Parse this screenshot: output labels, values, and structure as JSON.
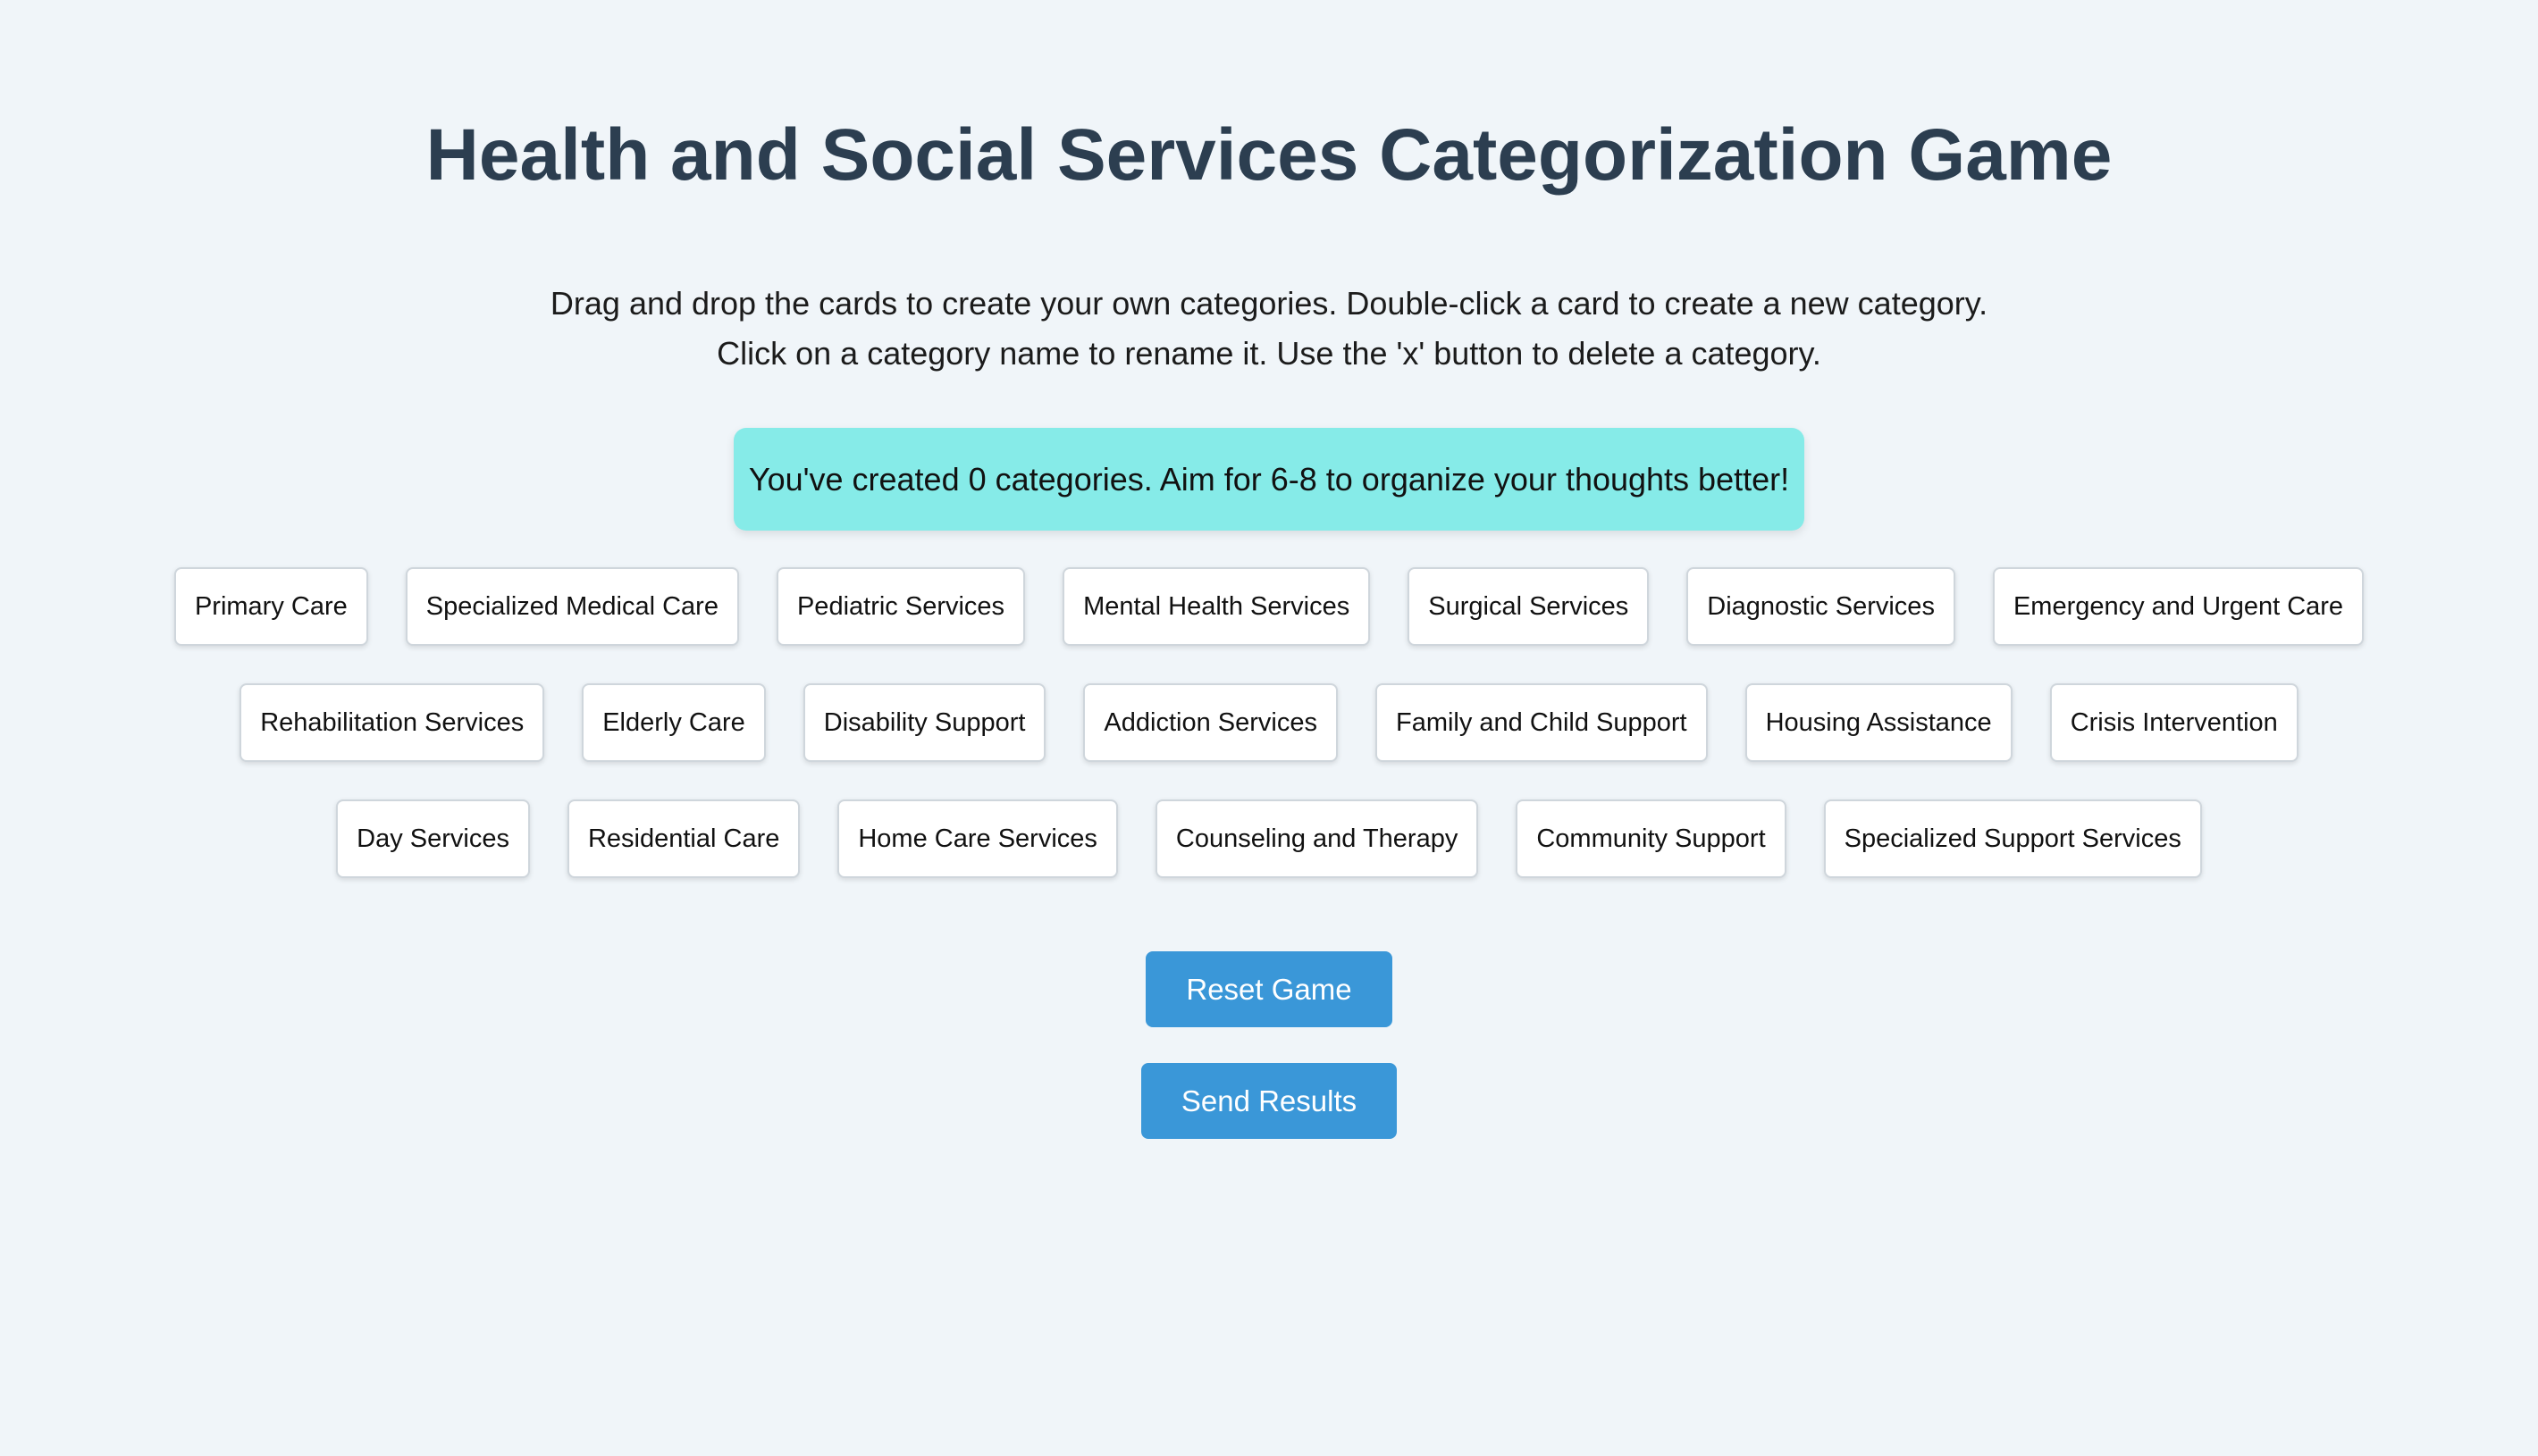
{
  "title": "Health and Social Services Categorization Game",
  "instructions": {
    "line1": "Drag and drop the cards to create your own categories. Double-click a card to create a new category.",
    "line2": "Click on a category name to rename it. Use the 'x' button to delete a category."
  },
  "status": {
    "text": "You've created 0 categories. Aim for 6-8 to organize your thoughts better!",
    "color": "#86ebe8"
  },
  "cards": [
    [
      "Primary Care",
      "Specialized Medical Care",
      "Pediatric Services",
      "Mental Health Services",
      "Surgical Services",
      "Diagnostic Services",
      "Emergency and Urgent Care"
    ],
    [
      "Rehabilitation Services",
      "Elderly Care",
      "Disability Support",
      "Addiction Services",
      "Family and Child Support",
      "Housing Assistance",
      "Crisis Intervention"
    ],
    [
      "Day Services",
      "Residential Care",
      "Home Care Services",
      "Counseling and Therapy",
      "Community Support",
      "Specialized Support Services"
    ]
  ],
  "buttons": {
    "reset_label": "Reset Game",
    "send_label": "Send Results",
    "color": "#3a97d8"
  },
  "colors": {
    "background": "#f0f5f9",
    "title": "#2c3e50"
  }
}
